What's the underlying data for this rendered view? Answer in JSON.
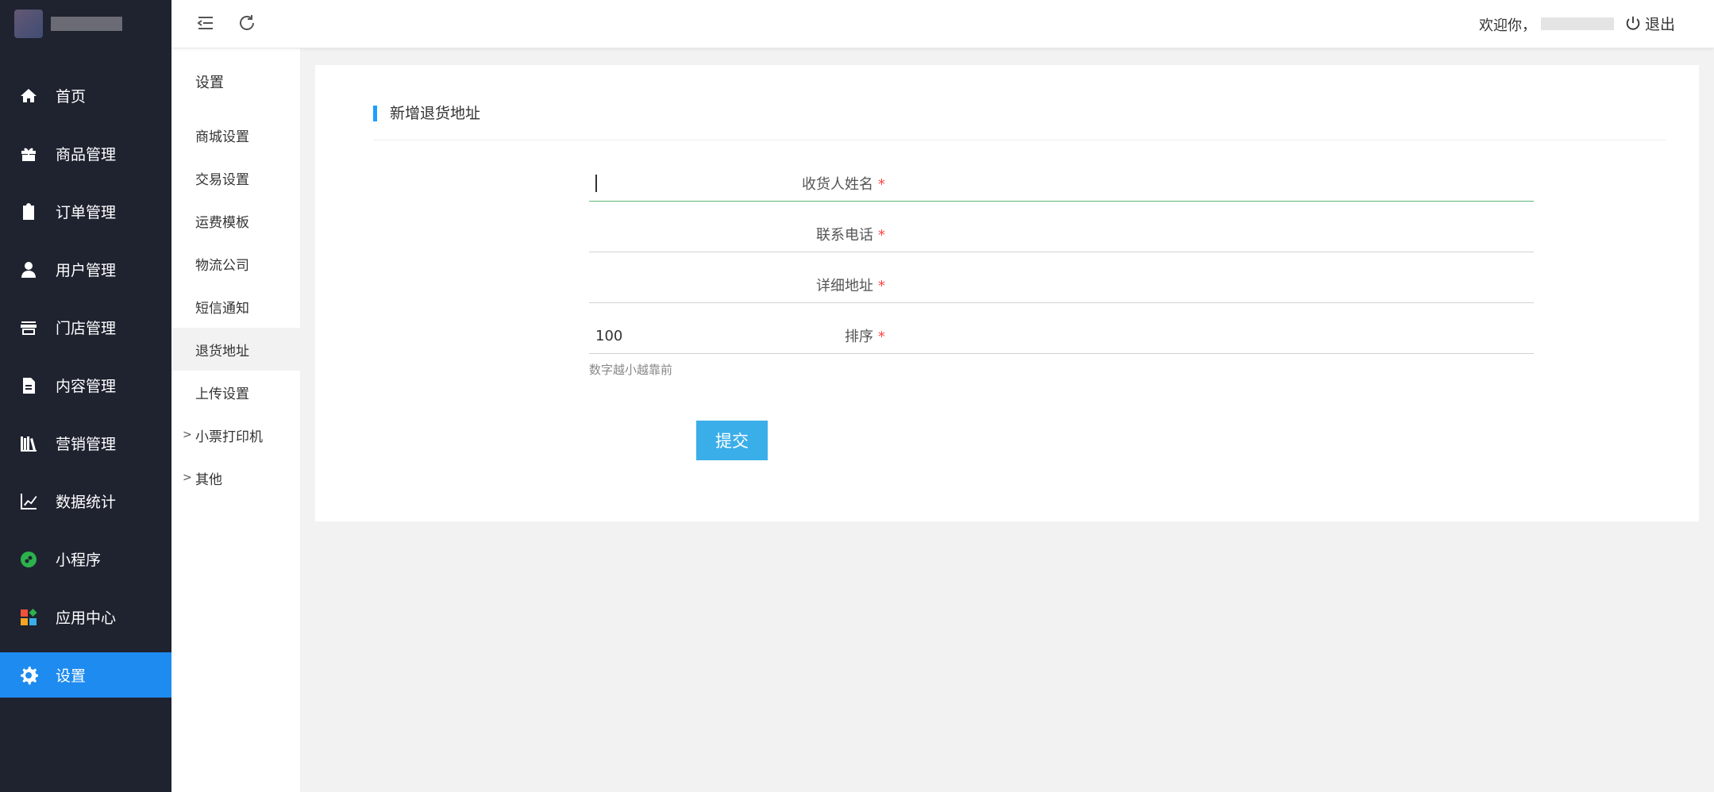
{
  "sidebar": {
    "items": [
      {
        "label": "首页",
        "icon": "home-icon"
      },
      {
        "label": "商品管理",
        "icon": "gift-icon"
      },
      {
        "label": "订单管理",
        "icon": "clipboard-icon"
      },
      {
        "label": "用户管理",
        "icon": "user-icon"
      },
      {
        "label": "门店管理",
        "icon": "store-icon"
      },
      {
        "label": "内容管理",
        "icon": "document-icon"
      },
      {
        "label": "营销管理",
        "icon": "books-icon"
      },
      {
        "label": "数据统计",
        "icon": "chart-line-icon"
      },
      {
        "label": "小程序",
        "icon": "miniprogram-icon"
      },
      {
        "label": "应用中心",
        "icon": "apps-icon"
      },
      {
        "label": "设置",
        "icon": "gear-icon"
      }
    ],
    "active_color": "#1e8bf0"
  },
  "subnav": {
    "title": "设置",
    "items": [
      {
        "label": "商城设置"
      },
      {
        "label": "交易设置"
      },
      {
        "label": "运费模板"
      },
      {
        "label": "物流公司"
      },
      {
        "label": "短信通知"
      },
      {
        "label": "退货地址"
      },
      {
        "label": "上传设置"
      },
      {
        "label": "小票打印机"
      },
      {
        "label": "其他"
      }
    ]
  },
  "topbar": {
    "welcome": "欢迎你，",
    "logout": "退出"
  },
  "form": {
    "title": "新增退货地址",
    "fields": [
      {
        "label": "收货人姓名",
        "value": ""
      },
      {
        "label": "联系电话",
        "value": ""
      },
      {
        "label": "详细地址",
        "value": ""
      },
      {
        "label": "排序",
        "value": "100"
      }
    ],
    "required_mark": "*",
    "sort_hint": "数字越小越靠前",
    "submit": "提交"
  }
}
